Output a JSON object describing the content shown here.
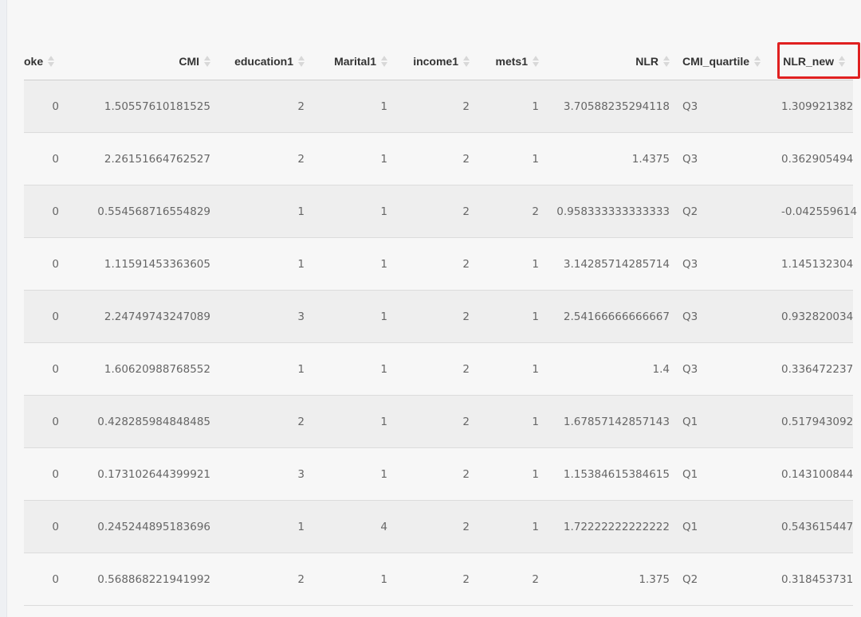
{
  "table": {
    "columns": [
      {
        "key": "smoke",
        "label": "oke",
        "align": "first"
      },
      {
        "key": "cmi",
        "label": "CMI",
        "align": "num"
      },
      {
        "key": "education1",
        "label": "education1",
        "align": "num"
      },
      {
        "key": "marital1",
        "label": "Marital1",
        "align": "num"
      },
      {
        "key": "income1",
        "label": "income1",
        "align": "num"
      },
      {
        "key": "mets1",
        "label": "mets1",
        "align": "num"
      },
      {
        "key": "nlr",
        "label": "NLR",
        "align": "num"
      },
      {
        "key": "cmi_quartile",
        "label": "CMI_quartile",
        "align": "txt"
      },
      {
        "key": "nlr_new",
        "label": "NLR_new",
        "align": "num",
        "highlighted": true
      }
    ],
    "rows": [
      [
        "0",
        "1.50557610181525",
        "2",
        "1",
        "2",
        "1",
        "3.70588235294118",
        "Q3",
        "1.309921382"
      ],
      [
        "0",
        "2.26151664762527",
        "2",
        "1",
        "2",
        "1",
        "1.4375",
        "Q3",
        "0.362905494"
      ],
      [
        "0",
        "0.554568716554829",
        "1",
        "1",
        "2",
        "2",
        "0.958333333333333",
        "Q2",
        "-0.042559614"
      ],
      [
        "0",
        "1.11591453363605",
        "1",
        "1",
        "2",
        "1",
        "3.14285714285714",
        "Q3",
        "1.145132304"
      ],
      [
        "0",
        "2.24749743247089",
        "3",
        "1",
        "2",
        "1",
        "2.54166666666667",
        "Q3",
        "0.932820034"
      ],
      [
        "0",
        "1.60620988768552",
        "1",
        "1",
        "2",
        "1",
        "1.4",
        "Q3",
        "0.336472237"
      ],
      [
        "0",
        "0.428285984848485",
        "2",
        "1",
        "2",
        "1",
        "1.67857142857143",
        "Q1",
        "0.517943092"
      ],
      [
        "0",
        "0.173102644399921",
        "3",
        "1",
        "2",
        "1",
        "1.15384615384615",
        "Q1",
        "0.143100844"
      ],
      [
        "0",
        "0.245244895183696",
        "1",
        "4",
        "2",
        "1",
        "1.72222222222222",
        "Q1",
        "0.543615447"
      ],
      [
        "0",
        "0.568868221941992",
        "2",
        "1",
        "2",
        "2",
        "1.375",
        "Q2",
        "0.318453731"
      ]
    ]
  },
  "colors": {
    "highlight_border": "#e02020",
    "row_odd": "#eeeeee",
    "row_even": "#f7f7f7"
  },
  "icons": {
    "sort": "sort-both-icon"
  }
}
